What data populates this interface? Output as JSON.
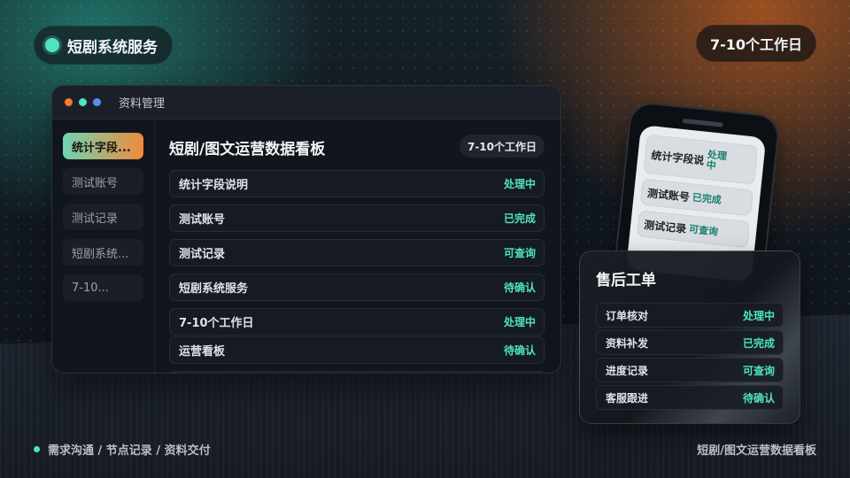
{
  "brand": {
    "label": "短剧系统服务"
  },
  "timeline": {
    "label": "7-10个工作日"
  },
  "window": {
    "title": "资料管理",
    "sidebar": [
      {
        "label": "统计字段...",
        "active": true
      },
      {
        "label": "测试账号"
      },
      {
        "label": "测试记录"
      },
      {
        "label": "短剧系统..."
      },
      {
        "label": "7-10..."
      }
    ],
    "content_title": "短剧/图文运营数据看板",
    "content_badge": "7-10个工作日",
    "rows": [
      {
        "label": "统计字段说明",
        "status": "处理中"
      },
      {
        "label": "测试账号",
        "status": "已完成"
      },
      {
        "label": "测试记录",
        "status": "可查询"
      },
      {
        "label": "短剧系统服务",
        "status": "待确认"
      },
      {
        "label": "7-10个工作日",
        "status": "处理中"
      },
      {
        "label": "运营看板",
        "status": "待确认"
      }
    ]
  },
  "phone": {
    "items": [
      {
        "label": "统计字段说",
        "status": "处理中"
      },
      {
        "label": "测试账号",
        "status": "已完成"
      },
      {
        "label": "测试记录",
        "status": "可查询"
      }
    ]
  },
  "after_sales": {
    "title": "售后工单",
    "rows": [
      {
        "label": "订单核对",
        "status": "处理中"
      },
      {
        "label": "资料补发",
        "status": "已完成"
      },
      {
        "label": "进度记录",
        "status": "可查询"
      },
      {
        "label": "客服跟进",
        "status": "待确认"
      }
    ]
  },
  "footer": {
    "left": "需求沟通 / 节点记录 / 资料交付",
    "right": "短剧/图文运营数据看板"
  },
  "colors": {
    "accent_teal": "#4fe3c2",
    "accent_orange": "#f07a2e",
    "window_bg": "#11161d"
  }
}
